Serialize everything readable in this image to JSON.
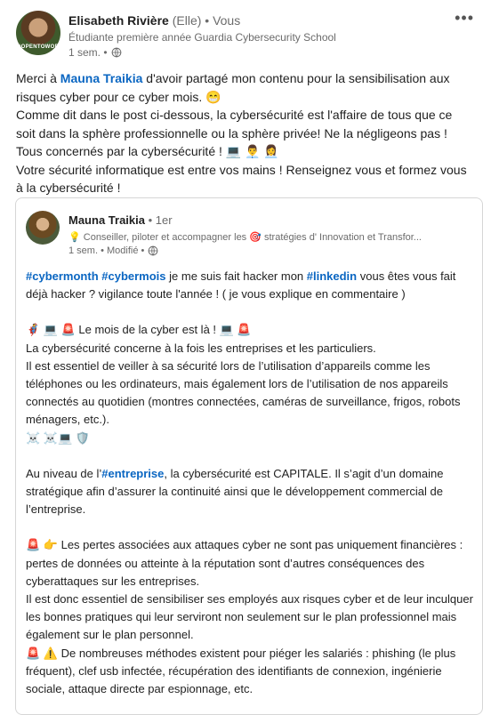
{
  "post": {
    "author_name": "Elisabeth Rivière",
    "author_pronoun": "(Elle)",
    "author_relation": "• Vous",
    "headline": "Étudiante première année Guardia Cybersecurity School",
    "time": "1 sem. •",
    "avatar_badge": "#OPENTOWORK",
    "more_label": "•••",
    "lines": {
      "l1_a": "Merci à ",
      "l1_mention": "Mauna Traikia",
      "l1_b": " d'avoir partagé mon contenu pour la sensibilisation aux risques cyber pour ce cyber mois. 😁",
      "l2": "Comme dit dans le post ci-dessous, la cybersécurité est l'affaire de tous que ce soit dans la sphère professionnelle ou la sphère privée! Ne la négligeons pas !",
      "l3": "Tous concernés par la cybersécurité ! 💻 👨‍💼 👩‍💼",
      "l4": "Votre sécurité informatique est entre vos mains ! Renseignez vous et formez vous à la cybersécurité !"
    }
  },
  "shared": {
    "author_name": "Mauna Traikia",
    "author_degree": "• 1er",
    "headline": "💡 Conseiller, piloter et accompagner les 🎯 stratégies d' Innovation et Transfor...",
    "time": "1 sem. • Modifié •",
    "p1_tag1": "#cybermonth",
    "p1_tag2": "#cybermois",
    "p1_a": " je me suis fait hacker mon ",
    "p1_tag3": "#linkedin",
    "p1_b": " vous êtes vous fait déjà hacker ? vigilance toute l'année ! ( je vous explique en commentaire )",
    "p2_title": "🦸 💻 🚨 Le mois de la cyber est là ! 💻 🚨",
    "p2_a": "La cybersécurité concerne à la fois les entreprises et les particuliers.",
    "p2_b": "Il est essentiel de veiller à sa sécurité lors de l’utilisation d’appareils comme les téléphones ou les ordinateurs, mais également lors de l’utilisation de nos appareils connectés au quotidien (montres connectées, caméras de surveillance, frigos, robots ménagers, etc.).",
    "p2_c": "☠️ ☠️💻 🛡️",
    "p3_a": "Au niveau de l’",
    "p3_tag": "#entreprise",
    "p3_b": ", la cybersécurité est CAPITALE. Il s’agit d’un domaine stratégique afin d’assurer la continuité ainsi que le développement commercial de l’entreprise.",
    "p4_a": "🚨 👉 Les pertes associées aux attaques cyber ne sont pas uniquement financières : pertes de données ou atteinte à la réputation sont d’autres conséquences des cyberattaques sur les entreprises.",
    "p4_b": "Il est donc essentiel de sensibiliser ses employés aux risques cyber et de leur inculquer les bonnes pratiques qui leur serviront non seulement sur le plan professionnel mais également sur le plan personnel.",
    "p4_c": "🚨 ⚠️ De nombreuses méthodes existent pour piéger les salariés : phishing (le plus fréquent), clef usb infectée, récupération des identifiants de connexion, ingénierie sociale, attaque directe par espionnage, etc."
  }
}
